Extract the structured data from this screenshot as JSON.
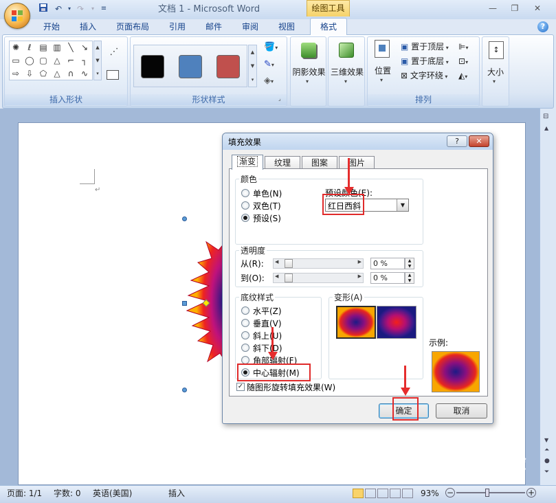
{
  "window": {
    "title": "文档 1 - Microsoft Word",
    "context_tab_title": "绘图工具"
  },
  "tabs": [
    "开始",
    "插入",
    "页面布局",
    "引用",
    "邮件",
    "审阅",
    "视图",
    "格式"
  ],
  "ribbon": {
    "groups": {
      "insert_shapes": "插入形状",
      "shape_styles": "形状样式",
      "shadow_effects": "阴影效果",
      "effects_3d": "三维效果",
      "arrange": "排列",
      "size": "大小"
    },
    "arrange": {
      "position": "位置",
      "bring_to_front": "置于顶层",
      "send_to_back": "置于底层",
      "text_wrap": "文字环绕"
    },
    "style_swatches": [
      "#050505",
      "#4f81bd",
      "#c0504d"
    ]
  },
  "status": {
    "page": "页面: 1/1",
    "words": "字数: 0",
    "language": "英语(美国)",
    "mode": "插入",
    "zoom": "93%"
  },
  "dialog": {
    "title": "填充效果",
    "tabs": [
      "渐变",
      "纹理",
      "图案",
      "图片"
    ],
    "color_group": "颜色",
    "color_options": [
      "单色(N)",
      "双色(T)",
      "预设(S)"
    ],
    "preset_label": "预设颜色(E):",
    "preset_value": "红日西斜",
    "transparency_group": "透明度",
    "from_label": "从(R):",
    "to_label": "到(O):",
    "from_value": "0 %",
    "to_value": "0 %",
    "shading_group": "底纹样式",
    "shading_options": [
      "水平(Z)",
      "垂直(V)",
      "斜上(U)",
      "斜下(D)",
      "角部辐射(F)",
      "中心辐射(M)"
    ],
    "variants_label": "变形(A)",
    "sample_label": "示例:",
    "rotate_with_shape": "随图形旋转填充效果(W)",
    "ok": "确定",
    "cancel": "取消",
    "help_btn": "?",
    "close_btn": "✕"
  },
  "watermark": "Baidu经验"
}
